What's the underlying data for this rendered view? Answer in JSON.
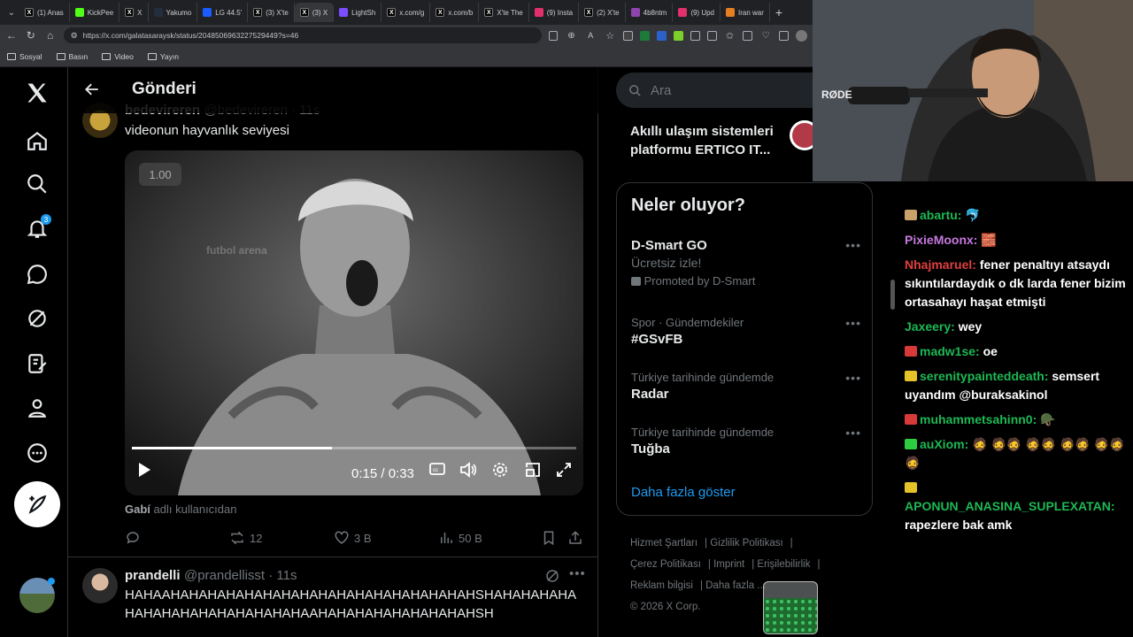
{
  "browser": {
    "tabs": [
      {
        "label": "(1) Anas",
        "icon": "x-favicon"
      },
      {
        "label": "KickPee",
        "icon": "kick-favicon"
      },
      {
        "label": "X",
        "icon": "x-favicon"
      },
      {
        "label": "Yakumo",
        "icon": "amazon-favicon"
      },
      {
        "label": "LG 44.5'",
        "icon": "v-favicon"
      },
      {
        "label": "(3) X'te",
        "icon": "x-favicon"
      },
      {
        "label": "(3) X",
        "icon": "x-favicon"
      },
      {
        "label": "LightSh",
        "icon": "lightshot-favicon"
      },
      {
        "label": "x.com/g",
        "icon": "x-favicon"
      },
      {
        "label": "x.com/b",
        "icon": "x-favicon"
      },
      {
        "label": "X'te The",
        "icon": "x-favicon"
      },
      {
        "label": "(9) Insta",
        "icon": "instagram-favicon"
      },
      {
        "label": "(2) X'te",
        "icon": "x-favicon"
      },
      {
        "label": "4b8ntm",
        "icon": "purple-favicon"
      },
      {
        "label": "(9) Upd",
        "icon": "instagram-favicon"
      },
      {
        "label": "Iran war",
        "icon": "orange-favicon"
      }
    ],
    "url": "https://x.com/galatasaraysk/status/2048506963227529449?s=46",
    "bookmarks": [
      "Sosyal",
      "Basın",
      "Video",
      "Yayın"
    ]
  },
  "nav": {
    "notification_count": "3"
  },
  "header": {
    "title": "Gönderi"
  },
  "tweet": {
    "author_name": "bedevireren",
    "author_handle": "@bedevireren · 11s",
    "text": "videonun hayvanlık seviyesi",
    "video": {
      "speed_badge": "1.00",
      "watermark": "futbol arena",
      "time": "0:15 / 0:33",
      "progress": 0.45
    },
    "credit_name": "Gabí",
    "credit_suffix": "adlı kullanıcıdan",
    "retweets": "12",
    "likes": "3 B",
    "views": "50 B"
  },
  "reply": {
    "author_name": "prandelli",
    "author_handle": "@prandellisst · 11s",
    "text": "HAHAAHAHAHAHAHAHAHAHAHAHAHAHAHAHAHAHAHSHAHAHAHAHAHAHAHAHAHAHAHAHAHAHAAHAHAHAHAHAHAHAHAHSH"
  },
  "sidebar": {
    "search_placeholder": "Ara",
    "promo_text": "Akıllı ulaşım sistemleri platformu ERTICO IT...",
    "trends_title": "Neler oluyor?",
    "trends": [
      {
        "context": "",
        "title": "D-Smart GO",
        "subtitle": "Ücretsiz izle!",
        "promoted": "Promoted by D-Smart"
      },
      {
        "context": "Spor · Gündemdekiler",
        "title": "#GSvFB"
      },
      {
        "context": "Türkiye tarihinde gündemde",
        "title": "Radar"
      },
      {
        "context": "Türkiye tarihinde gündemde",
        "title": "Tuğba"
      }
    ],
    "show_more": "Daha fazla göster",
    "footer": [
      "Hizmet Şartları",
      "Gizlilik Politikası",
      "Çerez Politikası",
      "Imprint",
      "Erişilebilirlik",
      "Reklam bilgisi",
      "Daha fazla ...",
      "© 2026 X Corp."
    ]
  },
  "webcam": {
    "mic_brand": "RØDE"
  },
  "chat": [
    {
      "user": "abartu:",
      "color": "#1db954",
      "text": "🐬",
      "badge": "#c9a26a"
    },
    {
      "user": "PixieMoonx:",
      "color": "#c678dd",
      "text": "🧱",
      "badge": ""
    },
    {
      "user": "Nhajmaruel:",
      "color": "#e04040",
      "text": "fener penaltıyı atsaydı sıkıntılardaydık o dk larda fener bizim ortasahayı haşat etmişti",
      "badge": ""
    },
    {
      "user": "Jaxeery:",
      "color": "#1db954",
      "text": "wey",
      "badge": ""
    },
    {
      "user": "madw1se:",
      "color": "#1db954",
      "text": "oe",
      "badge": "#d83a3a"
    },
    {
      "user": "serenitypainteddeath:",
      "color": "#1db954",
      "text": "semsert uyandım @buraksakinol",
      "badge": "#e6c229"
    },
    {
      "user": "muhammetsahinn0:",
      "color": "#1db954",
      "text": "🪖",
      "badge": "#d83a3a"
    },
    {
      "user": "auXiom:",
      "color": "#1db954",
      "text": "🧔 🧔🧔 🧔🧔 🧔🧔 🧔🧔 🧔",
      "badge": "#2ecc40"
    },
    {
      "user": "APONUN_ANASINA_SUPLEXATAN:",
      "color": "#1db954",
      "text": "rapezlere bak amk",
      "badge": "#e6c229"
    }
  ]
}
